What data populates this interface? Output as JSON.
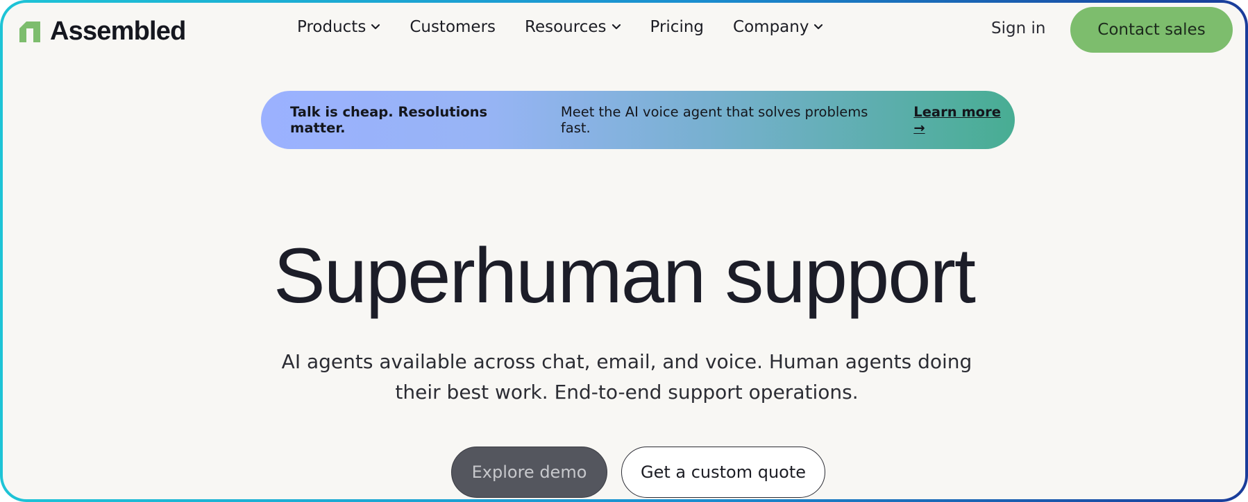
{
  "brand": {
    "name": "Assembled",
    "logo_icon": "assembled-logo-icon",
    "logo_color": "#7dbd6d"
  },
  "nav": {
    "items": [
      {
        "label": "Products",
        "has_dropdown": true
      },
      {
        "label": "Customers",
        "has_dropdown": false
      },
      {
        "label": "Resources",
        "has_dropdown": true
      },
      {
        "label": "Pricing",
        "has_dropdown": false
      },
      {
        "label": "Company",
        "has_dropdown": true
      }
    ],
    "dropdown_icon": "chevron-down-icon",
    "sign_in": "Sign in",
    "contact_sales": "Contact sales",
    "contact_color": "#7dbd6d"
  },
  "banner": {
    "headline": "Talk is cheap. Resolutions matter.",
    "text": "Meet the AI voice agent that solves problems fast.",
    "link": "Learn more →"
  },
  "hero": {
    "title": "Superhuman support",
    "subtitle": "AI agents available across chat, email, and voice. Human agents doing their best work. End-to-end support operations.",
    "primary_button": "Explore demo",
    "secondary_button": "Get a custom quote"
  },
  "colors": {
    "background": "#f8f7f4",
    "text": "#1c1d28",
    "frame_border": "#1ec4d6"
  }
}
